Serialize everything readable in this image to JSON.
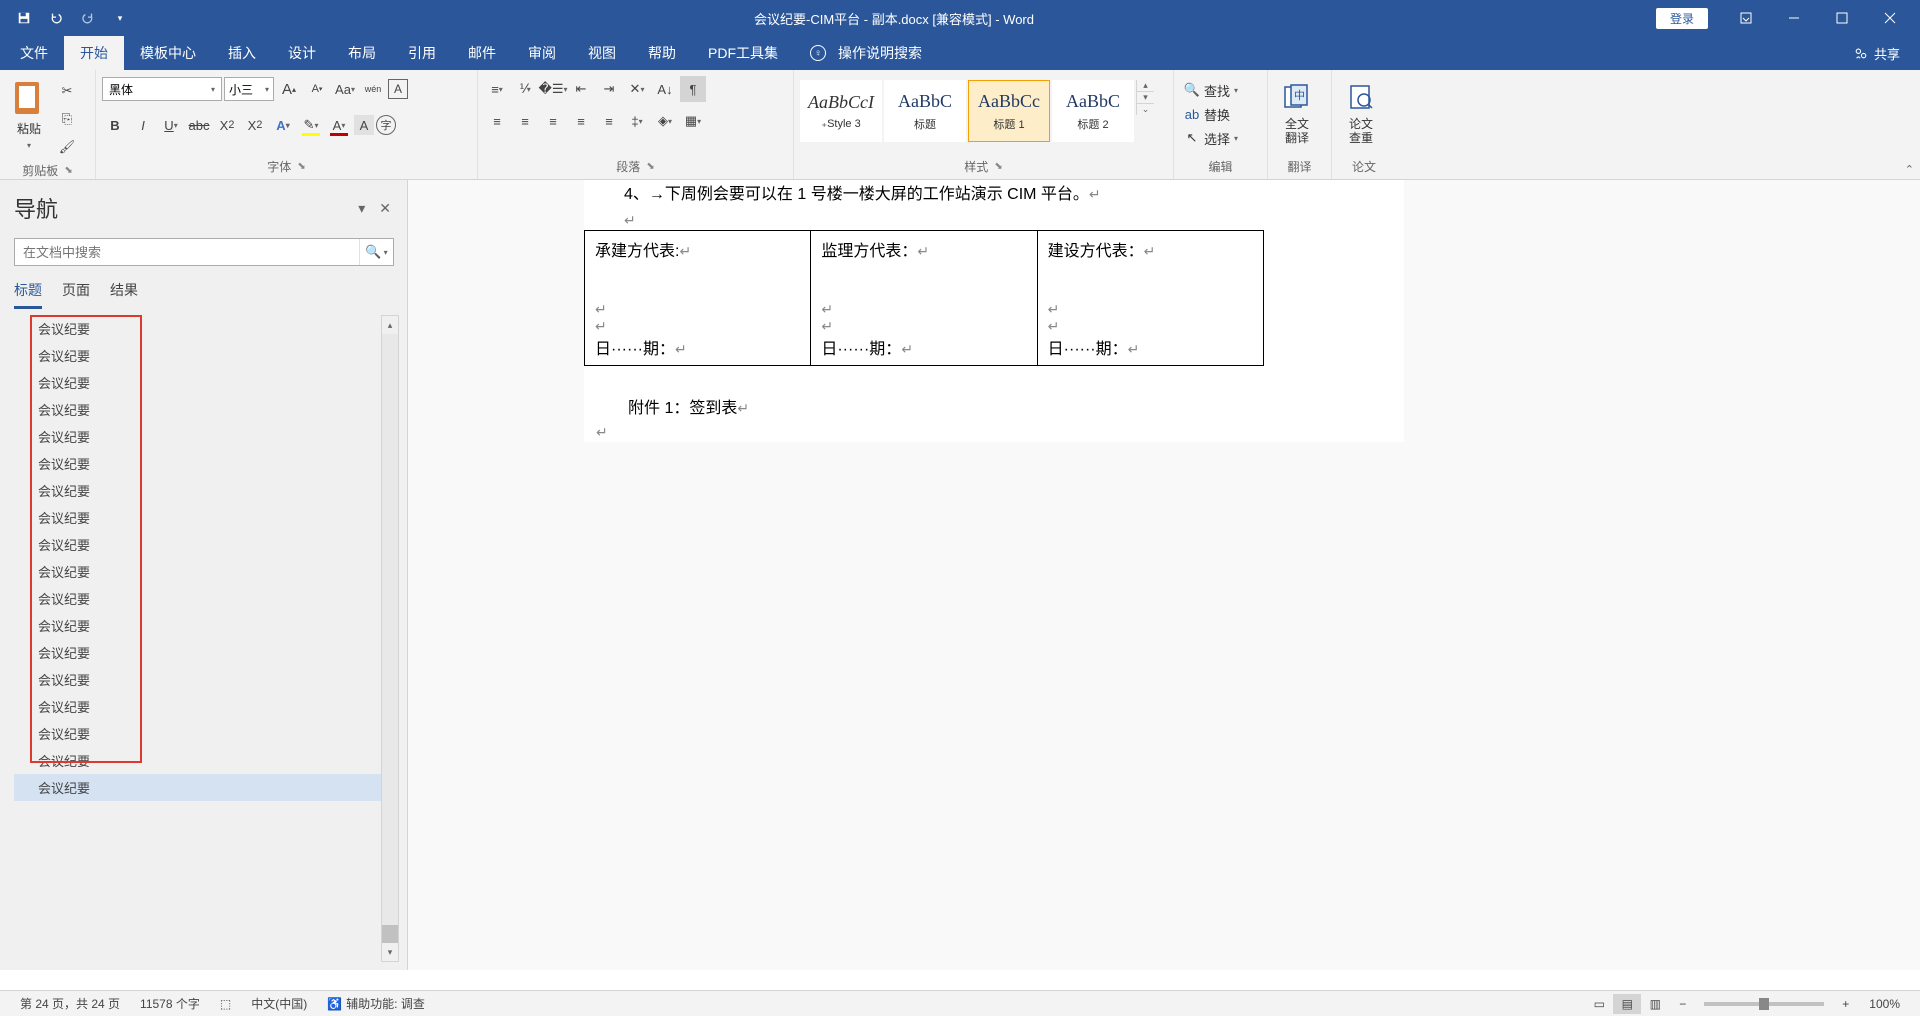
{
  "titlebar": {
    "title": "会议纪要-CIM平台 - 副本.docx [兼容模式] - Word",
    "login": "登录"
  },
  "menu": {
    "items": [
      "文件",
      "开始",
      "模板中心",
      "插入",
      "设计",
      "布局",
      "引用",
      "邮件",
      "审阅",
      "视图",
      "帮助",
      "PDF工具集"
    ],
    "tell_me": "操作说明搜索",
    "share": "共享"
  },
  "ribbon": {
    "clipboard": {
      "paste": "粘贴",
      "label": "剪贴板"
    },
    "font": {
      "name": "黑体",
      "size": "小三",
      "label": "字体"
    },
    "paragraph": {
      "label": "段落"
    },
    "styles": {
      "label": "样式",
      "items": [
        {
          "preview": "AaBbCcI",
          "name": "₊Style 3"
        },
        {
          "preview": "AaBbC",
          "name": "标题"
        },
        {
          "preview": "AaBbCc",
          "name": "标题 1"
        },
        {
          "preview": "AaBbC",
          "name": "标题 2"
        }
      ]
    },
    "editing": {
      "find": "查找",
      "replace": "替换",
      "select": "选择",
      "label": "编辑"
    },
    "translate": {
      "btn": "全文\n翻译",
      "label": "翻译"
    },
    "check": {
      "btn": "论文\n查重",
      "label": "论文"
    }
  },
  "nav": {
    "title": "导航",
    "search_placeholder": "在文档中搜索",
    "tabs": [
      "标题",
      "页面",
      "结果"
    ],
    "items": [
      "会议纪要",
      "会议纪要",
      "会议纪要",
      "会议纪要",
      "会议纪要",
      "会议纪要",
      "会议纪要",
      "会议纪要",
      "会议纪要",
      "会议纪要",
      "会议纪要",
      "会议纪要",
      "会议纪要",
      "会议纪要",
      "会议纪要",
      "会议纪要",
      "会议纪要",
      "会议纪要"
    ]
  },
  "document": {
    "line1": "4、→下周例会要可以在 1 号楼一楼大屏的工作站演示 CIM 平台。",
    "sig1": "承建方代表:",
    "sig2": "监理方代表：",
    "sig3": "建设方代表：",
    "date": "日······期：",
    "attach": "附件 1：签到表"
  },
  "status": {
    "page": "第 24 页，共 24 页",
    "words": "11578 个字",
    "lang": "中文(中国)",
    "a11y": "辅助功能: 调查",
    "zoom": "100%"
  }
}
